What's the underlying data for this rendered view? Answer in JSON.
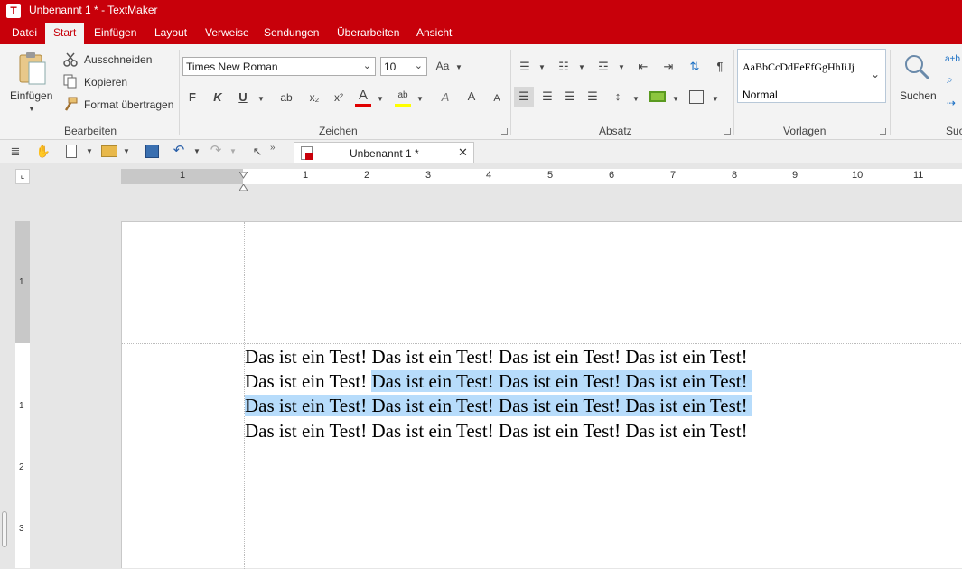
{
  "app": {
    "logo": "T",
    "window_title": "Unbenannt 1 * - TextMaker"
  },
  "menu": {
    "items": [
      "Datei",
      "Start",
      "Einfügen",
      "Layout",
      "Verweise",
      "Sendungen",
      "Überarbeiten",
      "Ansicht"
    ],
    "active": "Start"
  },
  "ribbon": {
    "bearbeiten": {
      "paste_label": "Einfügen",
      "cut_label": "Ausschneiden",
      "copy_label": "Kopieren",
      "format_painter_label": "Format übertragen",
      "group_label": "Bearbeiten"
    },
    "zeichen": {
      "font_name": "Times New Roman",
      "font_size": "10",
      "bold_label": "F",
      "italic_label": "K",
      "underline_label": "U",
      "strike_label": "ab",
      "sub_label": "x₂",
      "super_label": "x²",
      "font_color_label": "A",
      "highlight_label": "ab",
      "grow_label": "A",
      "shrink_label": "A",
      "group_label": "Zeichen",
      "font_color": "#e00000",
      "highlight_color": "#ffff00"
    },
    "absatz": {
      "group_label": "Absatz",
      "shading_color": "#8dc63f"
    },
    "vorlagen": {
      "preview_text": "AaBbCcDdEeFfGgHhIiJj",
      "style_name": "Normal",
      "group_label": "Vorlagen"
    },
    "suchen": {
      "search_label": "Suchen",
      "group_label": "Suc"
    }
  },
  "document_tab": {
    "title": "Unbenannt 1 *"
  },
  "ruler": {
    "h_numbers": [
      "1",
      "1",
      "2",
      "3",
      "4",
      "5",
      "6",
      "7",
      "8",
      "9",
      "10",
      "11"
    ],
    "v_numbers": [
      "1",
      "1",
      "2",
      "3"
    ]
  },
  "document": {
    "lines": [
      {
        "plain": "Das ist ein Test! Das ist ein Test! Das ist ein Test! Das ist ein Test!",
        "selected": ""
      },
      {
        "plain": "Das ist ein Test! ",
        "selected": "Das ist ein Test! Das ist ein Test! Das ist ein Test! "
      },
      {
        "plain": "",
        "selected": "Das ist ein Test! Das ist ein Test! Das ist ein Test! Das ist ein Test! "
      },
      {
        "plain": "Das ist ein Test! Das ist ein Test! Das ist ein Test! Das ist ein Test!",
        "selected": ""
      }
    ],
    "selection_color": "#b7dcfb"
  }
}
